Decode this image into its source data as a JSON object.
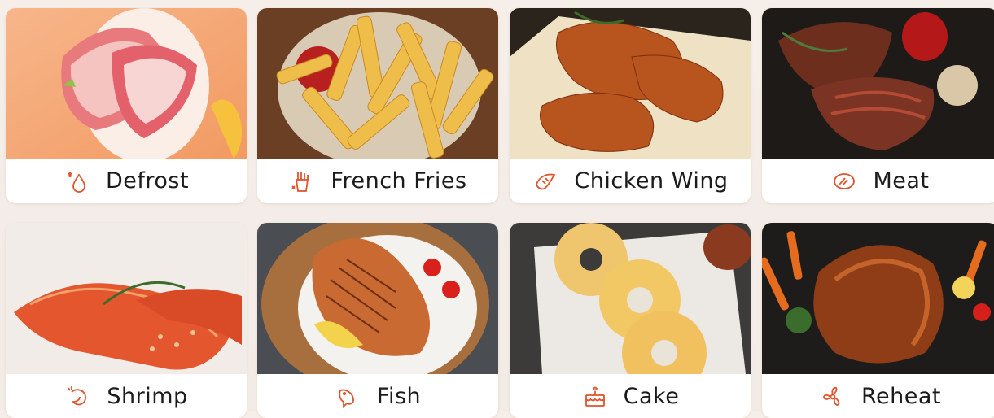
{
  "accent": "#e0532b",
  "programs": [
    {
      "label": "Defrost",
      "icon": "water-drop-icon"
    },
    {
      "label": "French Fries",
      "icon": "fries-icon"
    },
    {
      "label": "Chicken Wing",
      "icon": "chicken-wing-icon"
    },
    {
      "label": "Meat",
      "icon": "steak-icon"
    },
    {
      "label": "Shrimp",
      "icon": "shrimp-icon"
    },
    {
      "label": "Fish",
      "icon": "fish-icon"
    },
    {
      "label": "Cake",
      "icon": "cake-icon"
    },
    {
      "label": "Reheat",
      "icon": "fan-icon"
    }
  ]
}
